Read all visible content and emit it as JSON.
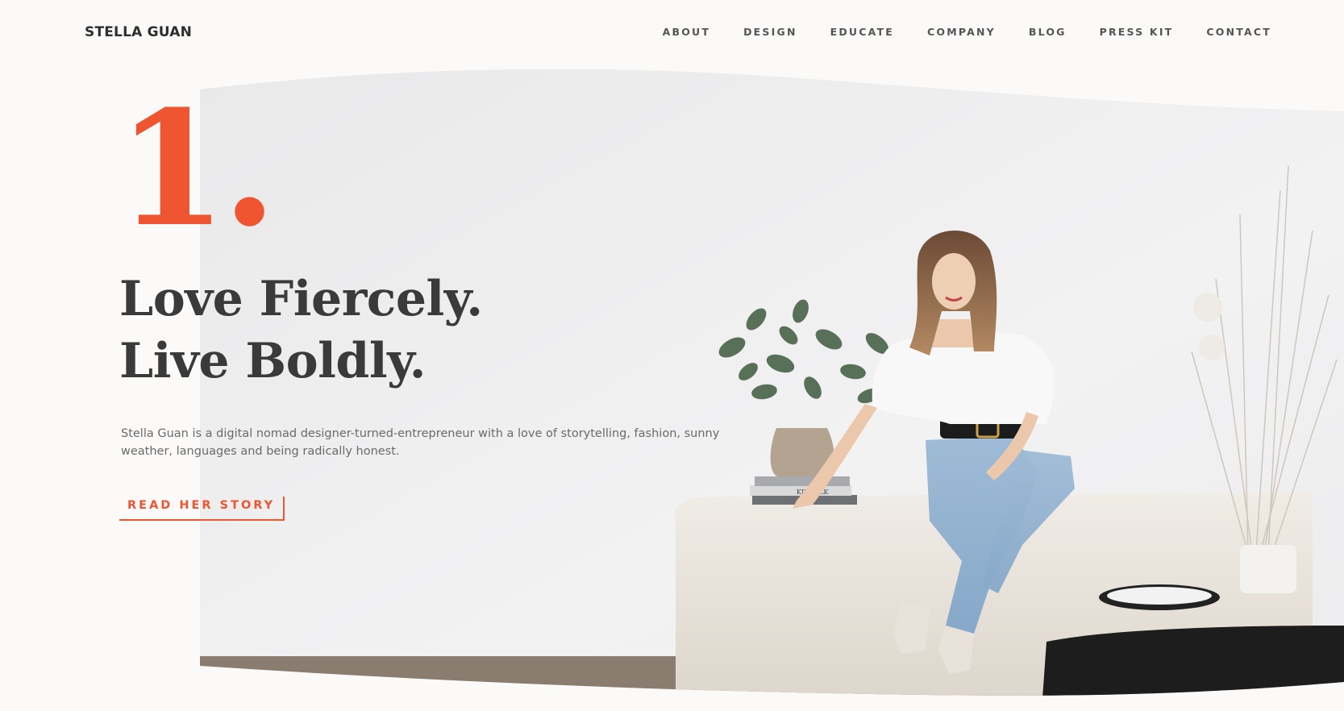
{
  "header": {
    "logo": "STELLA GUAN",
    "nav": [
      "ABOUT",
      "DESIGN",
      "EDUCATE",
      "COMPANY",
      "BLOG",
      "PRESS KIT",
      "CONTACT"
    ]
  },
  "hero": {
    "number": "1.",
    "headline_line1": "Love Fiercely.",
    "headline_line2": "Live Boldly.",
    "intro": "Stella Guan is a digital nomad designer-turned-entrepreneur with a love of storytelling, fashion, sunny weather, languages and being radically honest.",
    "cta_label": "READ HER STORY",
    "book_spine": "KINFOLK"
  },
  "colors": {
    "accent": "#ef5531",
    "heading": "#3a3a3a",
    "background": "#fbfaf9"
  }
}
